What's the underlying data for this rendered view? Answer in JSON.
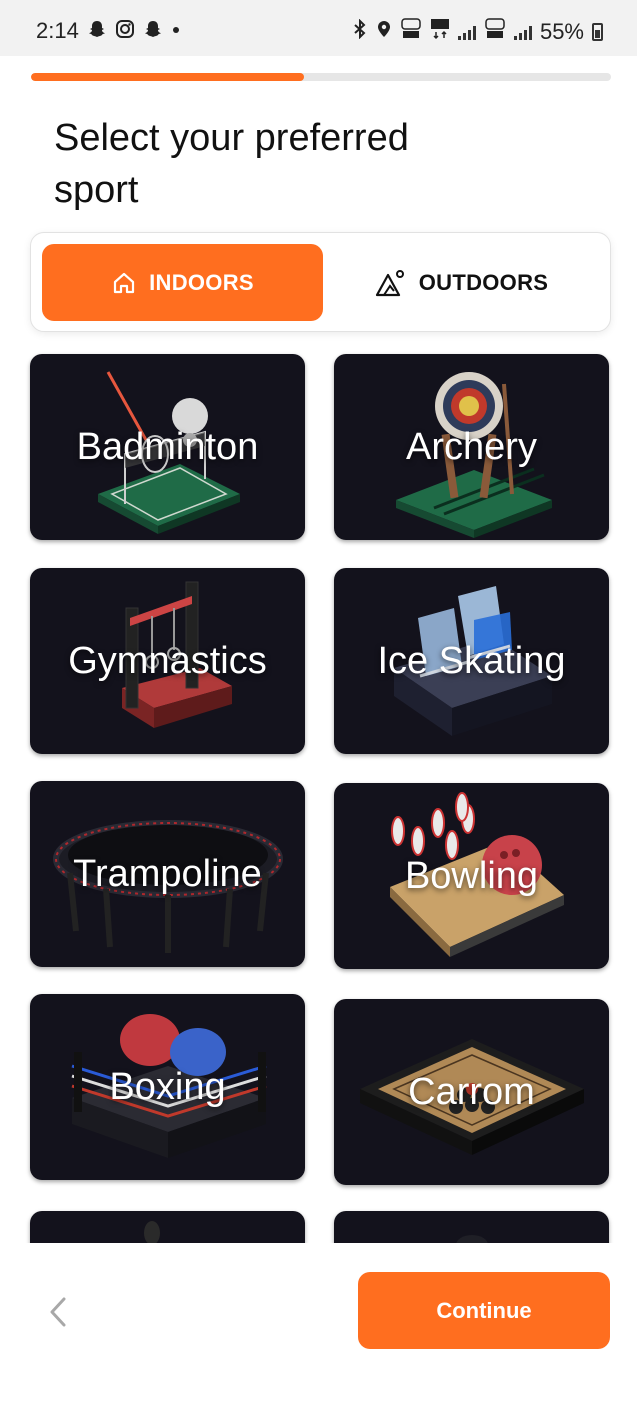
{
  "status_bar": {
    "time": "2:14",
    "battery": "55%",
    "notification_icons": [
      "snapchat-icon",
      "instagram-icon",
      "snapchat-icon",
      "dot-icon"
    ],
    "system_icons": [
      "bluetooth-icon",
      "location-icon",
      "volte-lte1-icon",
      "5g-icon",
      "signal-icon",
      "volte-lte2-icon",
      "signal-icon",
      "battery-icon"
    ]
  },
  "progress": {
    "value": 0.47,
    "color": "#ff6e1f"
  },
  "title": "Select your preferred sport",
  "tabs": [
    {
      "label": "INDOORS",
      "icon": "home-icon",
      "active": true
    },
    {
      "label": "OUTDOORS",
      "icon": "mountain-icon",
      "active": false
    }
  ],
  "sports": [
    {
      "label": "Badminton",
      "art": "badminton"
    },
    {
      "label": "Archery",
      "art": "archery"
    },
    {
      "label": "Gymnastics",
      "art": "gymnastics"
    },
    {
      "label": "Ice Skating",
      "art": "iceskating"
    },
    {
      "label": "Trampoline",
      "art": "trampoline"
    },
    {
      "label": "Bowling",
      "art": "bowling"
    },
    {
      "label": "Boxing",
      "art": "boxing"
    },
    {
      "label": "Carrom",
      "art": "carrom"
    }
  ],
  "footer": {
    "back_icon": "chevron-left-icon",
    "continue_label": "Continue"
  },
  "colors": {
    "accent": "#ff6e1f",
    "card_bg": "#13121c"
  }
}
